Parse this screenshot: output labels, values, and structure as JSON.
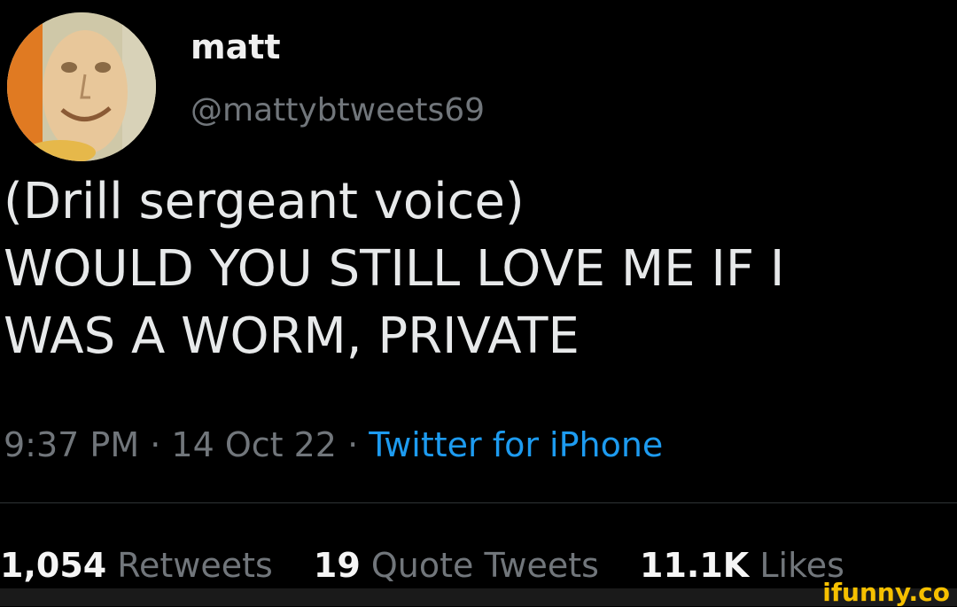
{
  "user": {
    "display_name": "matt",
    "handle": "@mattybtweets69"
  },
  "tweet": {
    "lines": [
      "(Drill sergeant voice)",
      "WOULD YOU STILL LOVE ME IF I",
      "WAS A WORM, PRIVATE"
    ],
    "time": "9:37 PM",
    "separator": "·",
    "date": "14 Oct 22",
    "source": "Twitter for iPhone"
  },
  "stats": {
    "retweets": {
      "count": "1,054",
      "label": "Retweets"
    },
    "quotes": {
      "count": "19",
      "label": "Quote Tweets"
    },
    "likes": {
      "count": "11.1K",
      "label": "Likes"
    }
  },
  "watermark": "ifunny.co",
  "colors": {
    "background": "#000000",
    "text": "#e7e9ea",
    "secondary": "#71767b",
    "link": "#1d9bf0",
    "watermark": "#f6c000"
  },
  "icons": {
    "avatar": "avatar-image"
  }
}
